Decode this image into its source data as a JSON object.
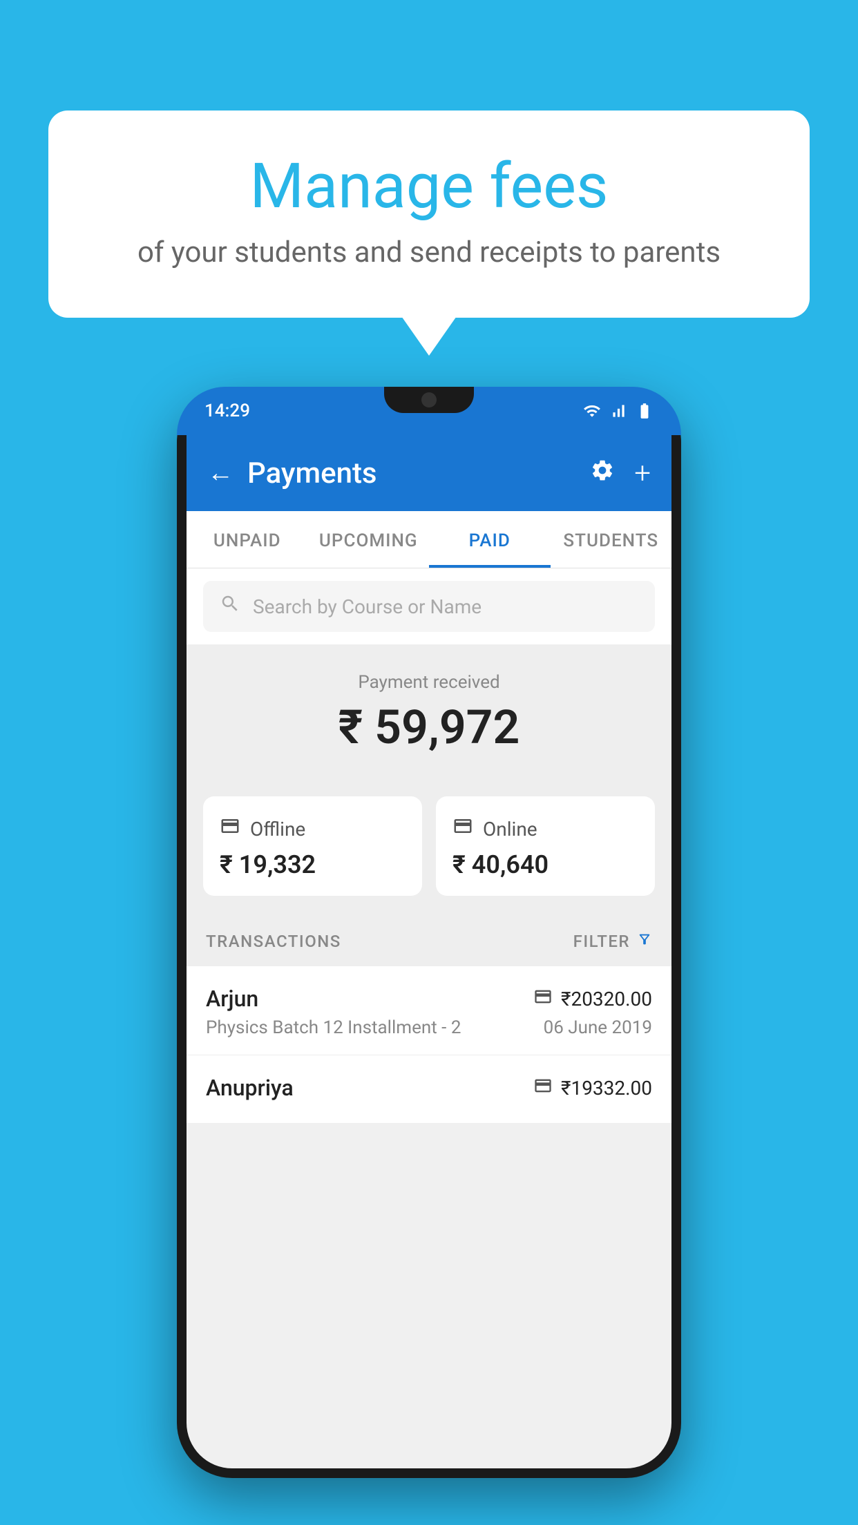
{
  "background_color": "#29b6e8",
  "speech_bubble": {
    "title": "Manage fees",
    "subtitle": "of your students and send receipts to parents"
  },
  "status_bar": {
    "time": "14:29",
    "icons": [
      "wifi",
      "signal",
      "battery"
    ]
  },
  "header": {
    "title": "Payments",
    "back_label": "←",
    "settings_label": "⚙",
    "add_label": "+"
  },
  "tabs": [
    {
      "label": "UNPAID",
      "active": false
    },
    {
      "label": "UPCOMING",
      "active": false
    },
    {
      "label": "PAID",
      "active": true
    },
    {
      "label": "STUDENTS",
      "active": false
    }
  ],
  "search": {
    "placeholder": "Search by Course or Name"
  },
  "payment_summary": {
    "label": "Payment received",
    "amount": "₹ 59,972",
    "offline_label": "Offline",
    "offline_amount": "₹ 19,332",
    "online_label": "Online",
    "online_amount": "₹ 40,640"
  },
  "transactions": {
    "header_label": "TRANSACTIONS",
    "filter_label": "FILTER",
    "items": [
      {
        "name": "Arjun",
        "amount": "₹20320.00",
        "payment_type": "card",
        "course": "Physics Batch 12 Installment - 2",
        "date": "06 June 2019"
      },
      {
        "name": "Anupriya",
        "amount": "₹19332.00",
        "payment_type": "offline",
        "course": "",
        "date": ""
      }
    ]
  }
}
